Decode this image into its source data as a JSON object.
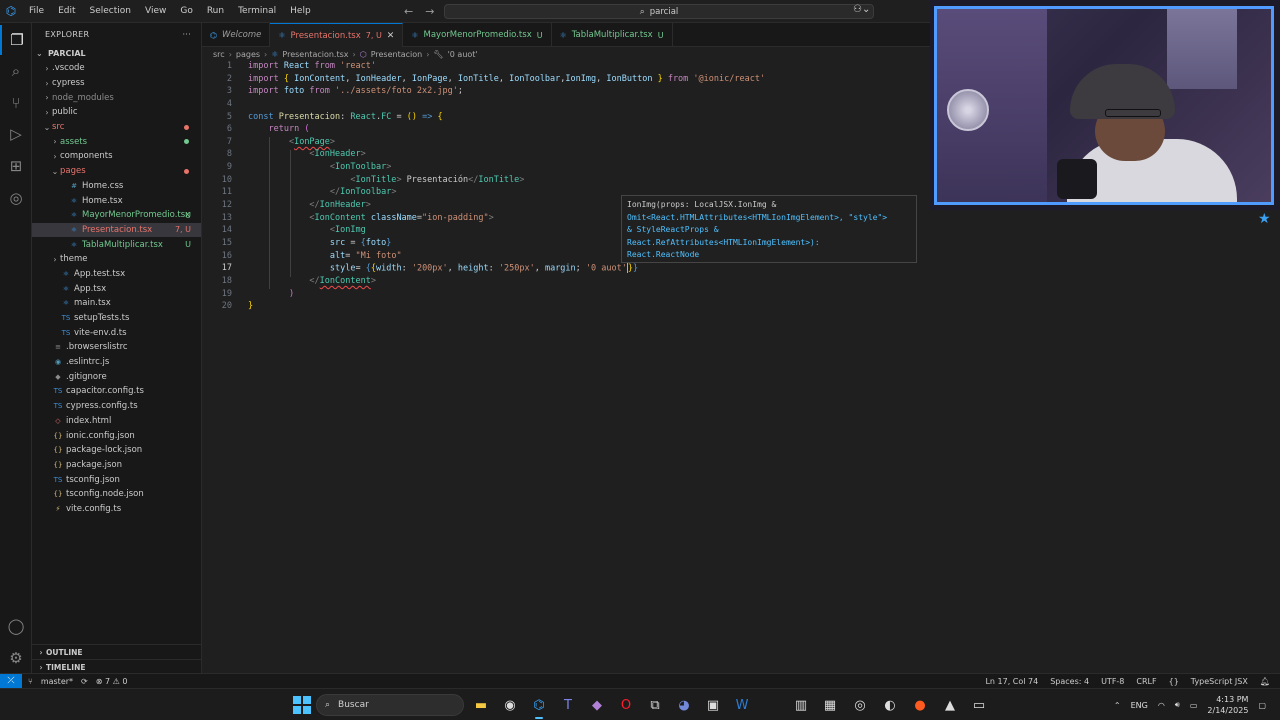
{
  "menu": [
    "File",
    "Edit",
    "Selection",
    "View",
    "Go",
    "Run",
    "Terminal",
    "Help"
  ],
  "search": {
    "text": "parcial"
  },
  "sidebar": {
    "title": "EXPLORER",
    "root": "PARCIAL",
    "items": [
      {
        "label": ".vscode",
        "type": "folder",
        "depth": 1,
        "chev": "›"
      },
      {
        "label": "cypress",
        "type": "folder",
        "depth": 1,
        "chev": "›"
      },
      {
        "label": "node_modules",
        "type": "folder-dim",
        "depth": 1,
        "chev": "›"
      },
      {
        "label": "public",
        "type": "folder",
        "depth": 1,
        "chev": "›"
      },
      {
        "label": "src",
        "type": "folder-red",
        "depth": 1,
        "chev": "⌄",
        "dot": "red"
      },
      {
        "label": "assets",
        "type": "folder-green",
        "depth": 2,
        "chev": "›",
        "dot": "green"
      },
      {
        "label": "components",
        "type": "folder",
        "depth": 2,
        "chev": "›"
      },
      {
        "label": "pages",
        "type": "folder-red",
        "depth": 2,
        "chev": "⌄",
        "dot": "red"
      },
      {
        "label": "Home.css",
        "type": "file-css",
        "depth": 3
      },
      {
        "label": "Home.tsx",
        "type": "file-tsx",
        "depth": 3
      },
      {
        "label": "MayorMenorPromedio.tsx",
        "type": "file-green",
        "depth": 3,
        "badge": "U"
      },
      {
        "label": "Presentacion.tsx",
        "type": "file-red",
        "depth": 3,
        "badge": "7, U",
        "selected": true
      },
      {
        "label": "TablaMultiplicar.tsx",
        "type": "file-green",
        "depth": 3,
        "badge": "U"
      },
      {
        "label": "theme",
        "type": "folder",
        "depth": 2,
        "chev": "›"
      },
      {
        "label": "App.test.tsx",
        "type": "file-tsx",
        "depth": 2
      },
      {
        "label": "App.tsx",
        "type": "file-tsx",
        "depth": 2
      },
      {
        "label": "main.tsx",
        "type": "file-tsx",
        "depth": 2
      },
      {
        "label": "setupTests.ts",
        "type": "file-ts",
        "depth": 2
      },
      {
        "label": "vite-env.d.ts",
        "type": "file-ts",
        "depth": 2
      },
      {
        "label": ".browserslistrc",
        "type": "file-gen",
        "depth": 1
      },
      {
        "label": ".eslintrc.js",
        "type": "file-js",
        "depth": 1
      },
      {
        "label": ".gitignore",
        "type": "file-git",
        "depth": 1
      },
      {
        "label": "capacitor.config.ts",
        "type": "file-ts",
        "depth": 1
      },
      {
        "label": "cypress.config.ts",
        "type": "file-ts",
        "depth": 1
      },
      {
        "label": "index.html",
        "type": "file-html",
        "depth": 1
      },
      {
        "label": "ionic.config.json",
        "type": "file-json",
        "depth": 1
      },
      {
        "label": "package-lock.json",
        "type": "file-json",
        "depth": 1
      },
      {
        "label": "package.json",
        "type": "file-json",
        "depth": 1
      },
      {
        "label": "tsconfig.json",
        "type": "file-tsc",
        "depth": 1
      },
      {
        "label": "tsconfig.node.json",
        "type": "file-json",
        "depth": 1
      },
      {
        "label": "vite.config.ts",
        "type": "file-vite",
        "depth": 1
      }
    ],
    "outline": "OUTLINE",
    "timeline": "TIMELINE"
  },
  "tabs": [
    {
      "label": "Welcome",
      "mod": "",
      "kind": "welcome"
    },
    {
      "label": "Presentacion.tsx",
      "mod": "7, U",
      "kind": "active"
    },
    {
      "label": "MayorMenorPromedio.tsx",
      "mod": "U",
      "kind": "normal"
    },
    {
      "label": "TablaMultiplicar.tsx",
      "mod": "U",
      "kind": "normal"
    }
  ],
  "breadcrumb": [
    "src",
    "pages",
    "Presentacion.tsx",
    "Presentacion",
    "'0 auot'"
  ],
  "code": {
    "current_line": 17,
    "lines": [
      [
        {
          "c": "k",
          "t": "import "
        },
        {
          "c": "v",
          "t": "React"
        },
        {
          "c": "k",
          "t": " from "
        },
        {
          "c": "s",
          "t": "'react'"
        }
      ],
      [
        {
          "c": "k",
          "t": "import "
        },
        {
          "c": "y",
          "t": "{ "
        },
        {
          "c": "v",
          "t": "IonContent"
        },
        {
          "c": "p",
          "t": ", "
        },
        {
          "c": "v",
          "t": "IonHeader"
        },
        {
          "c": "p",
          "t": ", "
        },
        {
          "c": "v",
          "t": "IonPage"
        },
        {
          "c": "p",
          "t": ", "
        },
        {
          "c": "v",
          "t": "IonTitle"
        },
        {
          "c": "p",
          "t": ", "
        },
        {
          "c": "v",
          "t": "IonToolbar"
        },
        {
          "c": "p",
          "t": ","
        },
        {
          "c": "v",
          "t": "IonImg"
        },
        {
          "c": "p",
          "t": ", "
        },
        {
          "c": "v",
          "t": "IonButton"
        },
        {
          "c": "y",
          "t": " }"
        },
        {
          "c": "k",
          "t": " from "
        },
        {
          "c": "s",
          "t": "'@ionic/react'"
        }
      ],
      [
        {
          "c": "k",
          "t": "import "
        },
        {
          "c": "v",
          "t": "foto"
        },
        {
          "c": "k",
          "t": " from "
        },
        {
          "c": "s",
          "t": "'../assets/foto 2x2.jpg'"
        },
        {
          "c": "p",
          "t": ";"
        }
      ],
      [],
      [
        {
          "c": "kw",
          "t": "const "
        },
        {
          "c": "f",
          "t": "Presentacion"
        },
        {
          "c": "p",
          "t": ": "
        },
        {
          "c": "t",
          "t": "React"
        },
        {
          "c": "p",
          "t": "."
        },
        {
          "c": "t",
          "t": "FC"
        },
        {
          "c": "p",
          "t": " = "
        },
        {
          "c": "y",
          "t": "()"
        },
        {
          "c": "kw",
          "t": " => "
        },
        {
          "c": "y",
          "t": "{"
        }
      ],
      [
        {
          "c": "p",
          "t": "    "
        },
        {
          "c": "k",
          "t": "return "
        },
        {
          "c": "m",
          "t": "("
        }
      ],
      [
        {
          "c": "p",
          "t": "        "
        },
        {
          "c": "br",
          "t": "<"
        },
        {
          "c": "tg",
          "t": "IonPage",
          "e": true
        },
        {
          "c": "br",
          "t": ">"
        }
      ],
      [
        {
          "c": "p",
          "t": "            "
        },
        {
          "c": "br",
          "t": "<"
        },
        {
          "c": "tg",
          "t": "IonHeader"
        },
        {
          "c": "br",
          "t": ">"
        }
      ],
      [
        {
          "c": "p",
          "t": "                "
        },
        {
          "c": "br",
          "t": "<"
        },
        {
          "c": "tg",
          "t": "IonToolbar"
        },
        {
          "c": "br",
          "t": ">"
        }
      ],
      [
        {
          "c": "p",
          "t": "                    "
        },
        {
          "c": "br",
          "t": "<"
        },
        {
          "c": "tg",
          "t": "IonTitle"
        },
        {
          "c": "br",
          "t": ">"
        },
        {
          "c": "p",
          "t": " Presentación"
        },
        {
          "c": "br",
          "t": "</"
        },
        {
          "c": "tg",
          "t": "IonTitle"
        },
        {
          "c": "br",
          "t": ">"
        }
      ],
      [
        {
          "c": "p",
          "t": "                "
        },
        {
          "c": "br",
          "t": "</"
        },
        {
          "c": "tg",
          "t": "IonToolbar"
        },
        {
          "c": "br",
          "t": ">"
        }
      ],
      [
        {
          "c": "p",
          "t": "            "
        },
        {
          "c": "br",
          "t": "</"
        },
        {
          "c": "tg",
          "t": "IonHeader"
        },
        {
          "c": "br",
          "t": ">"
        }
      ],
      [
        {
          "c": "p",
          "t": "            "
        },
        {
          "c": "br",
          "t": "<"
        },
        {
          "c": "tg",
          "t": "IonContent"
        },
        {
          "c": "v",
          "t": " className"
        },
        {
          "c": "p",
          "t": "="
        },
        {
          "c": "s",
          "t": "\"ion-padding\""
        },
        {
          "c": "br",
          "t": ">"
        }
      ],
      [
        {
          "c": "p",
          "t": "                "
        },
        {
          "c": "br",
          "t": "<"
        },
        {
          "c": "tg",
          "t": "IonImg"
        }
      ],
      [
        {
          "c": "p",
          "t": "                "
        },
        {
          "c": "v",
          "t": "src"
        },
        {
          "c": "p",
          "t": " = "
        },
        {
          "c": "kw",
          "t": "{"
        },
        {
          "c": "v",
          "t": "foto"
        },
        {
          "c": "kw",
          "t": "}"
        }
      ],
      [
        {
          "c": "p",
          "t": "                "
        },
        {
          "c": "v",
          "t": "alt"
        },
        {
          "c": "p",
          "t": "= "
        },
        {
          "c": "s",
          "t": "\"Mi foto\""
        }
      ],
      [
        {
          "c": "p",
          "t": "                "
        },
        {
          "c": "v",
          "t": "style"
        },
        {
          "c": "p",
          "t": "= "
        },
        {
          "c": "kw",
          "t": "{"
        },
        {
          "c": "y",
          "t": "{"
        },
        {
          "c": "v",
          "t": "width"
        },
        {
          "c": "p",
          "t": ": "
        },
        {
          "c": "s",
          "t": "'200px'"
        },
        {
          "c": "p",
          "t": ", "
        },
        {
          "c": "v",
          "t": "height"
        },
        {
          "c": "p",
          "t": ": "
        },
        {
          "c": "s",
          "t": "'250px'"
        },
        {
          "c": "p",
          "t": ", "
        },
        {
          "c": "v",
          "t": "margin"
        },
        {
          "c": "p",
          "t": "; "
        },
        {
          "c": "s",
          "t": "'0 auot'"
        },
        {
          "c": "cur",
          "t": ""
        },
        {
          "c": "y",
          "t": "}"
        },
        {
          "c": "kw",
          "t": "}"
        }
      ],
      [
        {
          "c": "p",
          "t": "            "
        },
        {
          "c": "br",
          "t": "</"
        },
        {
          "c": "tg",
          "t": "IonContent",
          "e": true
        },
        {
          "c": "br",
          "t": ">"
        }
      ],
      [
        {
          "c": "p",
          "t": "        "
        },
        {
          "c": "m",
          "t": ")"
        }
      ],
      [
        {
          "c": "y",
          "t": "}"
        }
      ]
    ]
  },
  "hover": {
    "lines": [
      "IonImg(props: LocalJSX.IonImg &",
      "Omit<React.HTMLAttributes<HTMLIonImgElement>, \"style\">",
      "& StyleReactProps &",
      "React.RefAttributes<HTMLIonImgElement>):",
      "React.ReactNode"
    ]
  },
  "statusbar": {
    "branch": "master*",
    "problems": "⊗ 7 ⚠ 0",
    "position": "Ln 17, Col 74",
    "spaces": "Spaces: 4",
    "encoding": "UTF-8",
    "eol": "CRLF",
    "language": "TypeScript JSX"
  },
  "taskbar": {
    "search_label": "Buscar",
    "lang": "ENG",
    "time": "4:13 PM",
    "date": "2/14/2025"
  },
  "colors": {
    "accent": "#0078d4",
    "modified_red": "#e8746c",
    "untracked_green": "#73c991"
  }
}
